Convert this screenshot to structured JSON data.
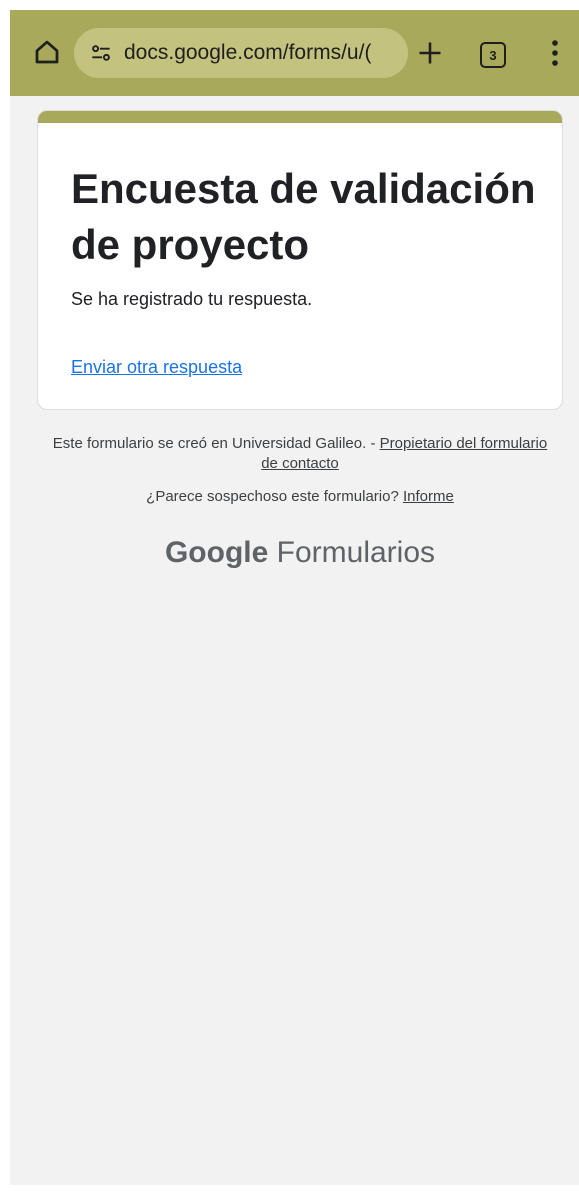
{
  "browser": {
    "url": "docs.google.com/forms/u/(",
    "tab_count": "3",
    "icons": {
      "home": "home-icon",
      "site_settings": "tune-icon",
      "new_tab": "plus-icon",
      "tabs": "tab-switcher-icon",
      "menu": "more-vert-icon"
    },
    "toolbar_color": "#a9a95b"
  },
  "form": {
    "title": "Encuesta de validación de proyecto",
    "confirmation": "Se ha registrado tu respuesta.",
    "another_response_link": "Enviar otra respuesta",
    "accent_color": "#a9a95b"
  },
  "footer": {
    "created_text": "Este formulario se creó en Universidad Galileo. - ",
    "contact_owner_link": "Propietario del formulario de contacto",
    "suspicious_text": "¿Parece sospechoso este formulario? ",
    "report_link": "Informe",
    "brand_google": "Google",
    "brand_product": " Formularios"
  }
}
